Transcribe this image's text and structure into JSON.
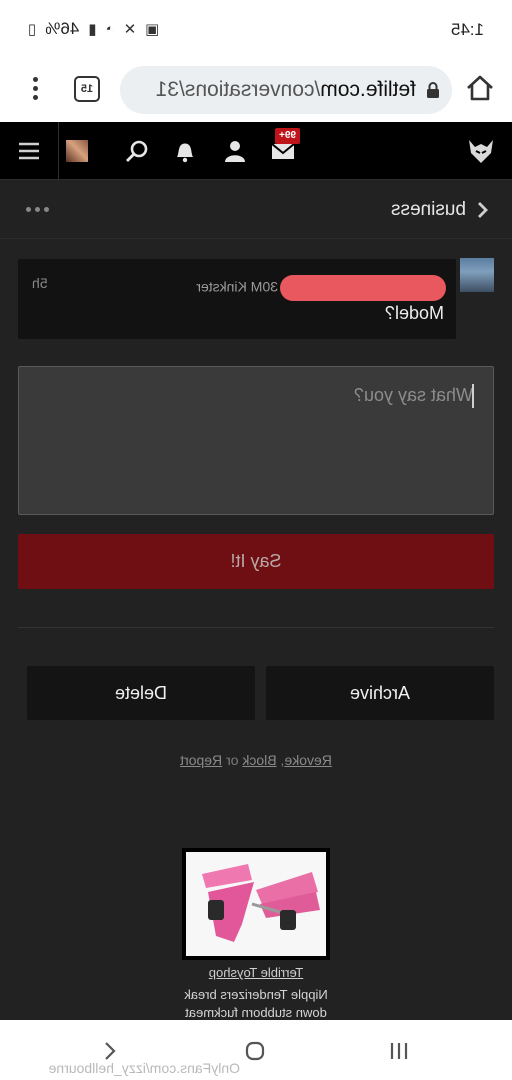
{
  "status_bar": {
    "time": "1:45",
    "battery": "46%",
    "icons": [
      "gallery-icon",
      "mute-icon",
      "wifi-icon",
      "signal-icon",
      "battery-icon"
    ]
  },
  "browser": {
    "url_host": "fetlife.com",
    "url_path": "/conversations/31",
    "tab_count": "15"
  },
  "nav": {
    "badge": "99+",
    "items": [
      "menu-icon",
      "profile-avatar",
      "search-icon",
      "notifications-bell-icon",
      "people-icon",
      "messages-envelope-icon"
    ]
  },
  "conversation": {
    "title": "business"
  },
  "message": {
    "author_suffix": "30M Kinkster",
    "time": "5h",
    "text": "Model?"
  },
  "reply": {
    "placeholder": "What say you?",
    "submit_label": "Say It!"
  },
  "actions": {
    "archive_label": "Archive",
    "delete_label": "Delete",
    "links": {
      "revoke": "Revoke",
      "comma": ", ",
      "block": "Block",
      "or": " or ",
      "report": "Report"
    }
  },
  "ad": {
    "shop": "Terrible Toyshop",
    "description": "Nipple Tenderizers break down stubborn fuckmeat"
  },
  "watermark": "OnlyFans.com/izzy_hellbourne",
  "colors": {
    "page_bg": "#222222",
    "primary_button": "#700f13",
    "badge": "#c0141b",
    "redaction": "#e8585e"
  }
}
